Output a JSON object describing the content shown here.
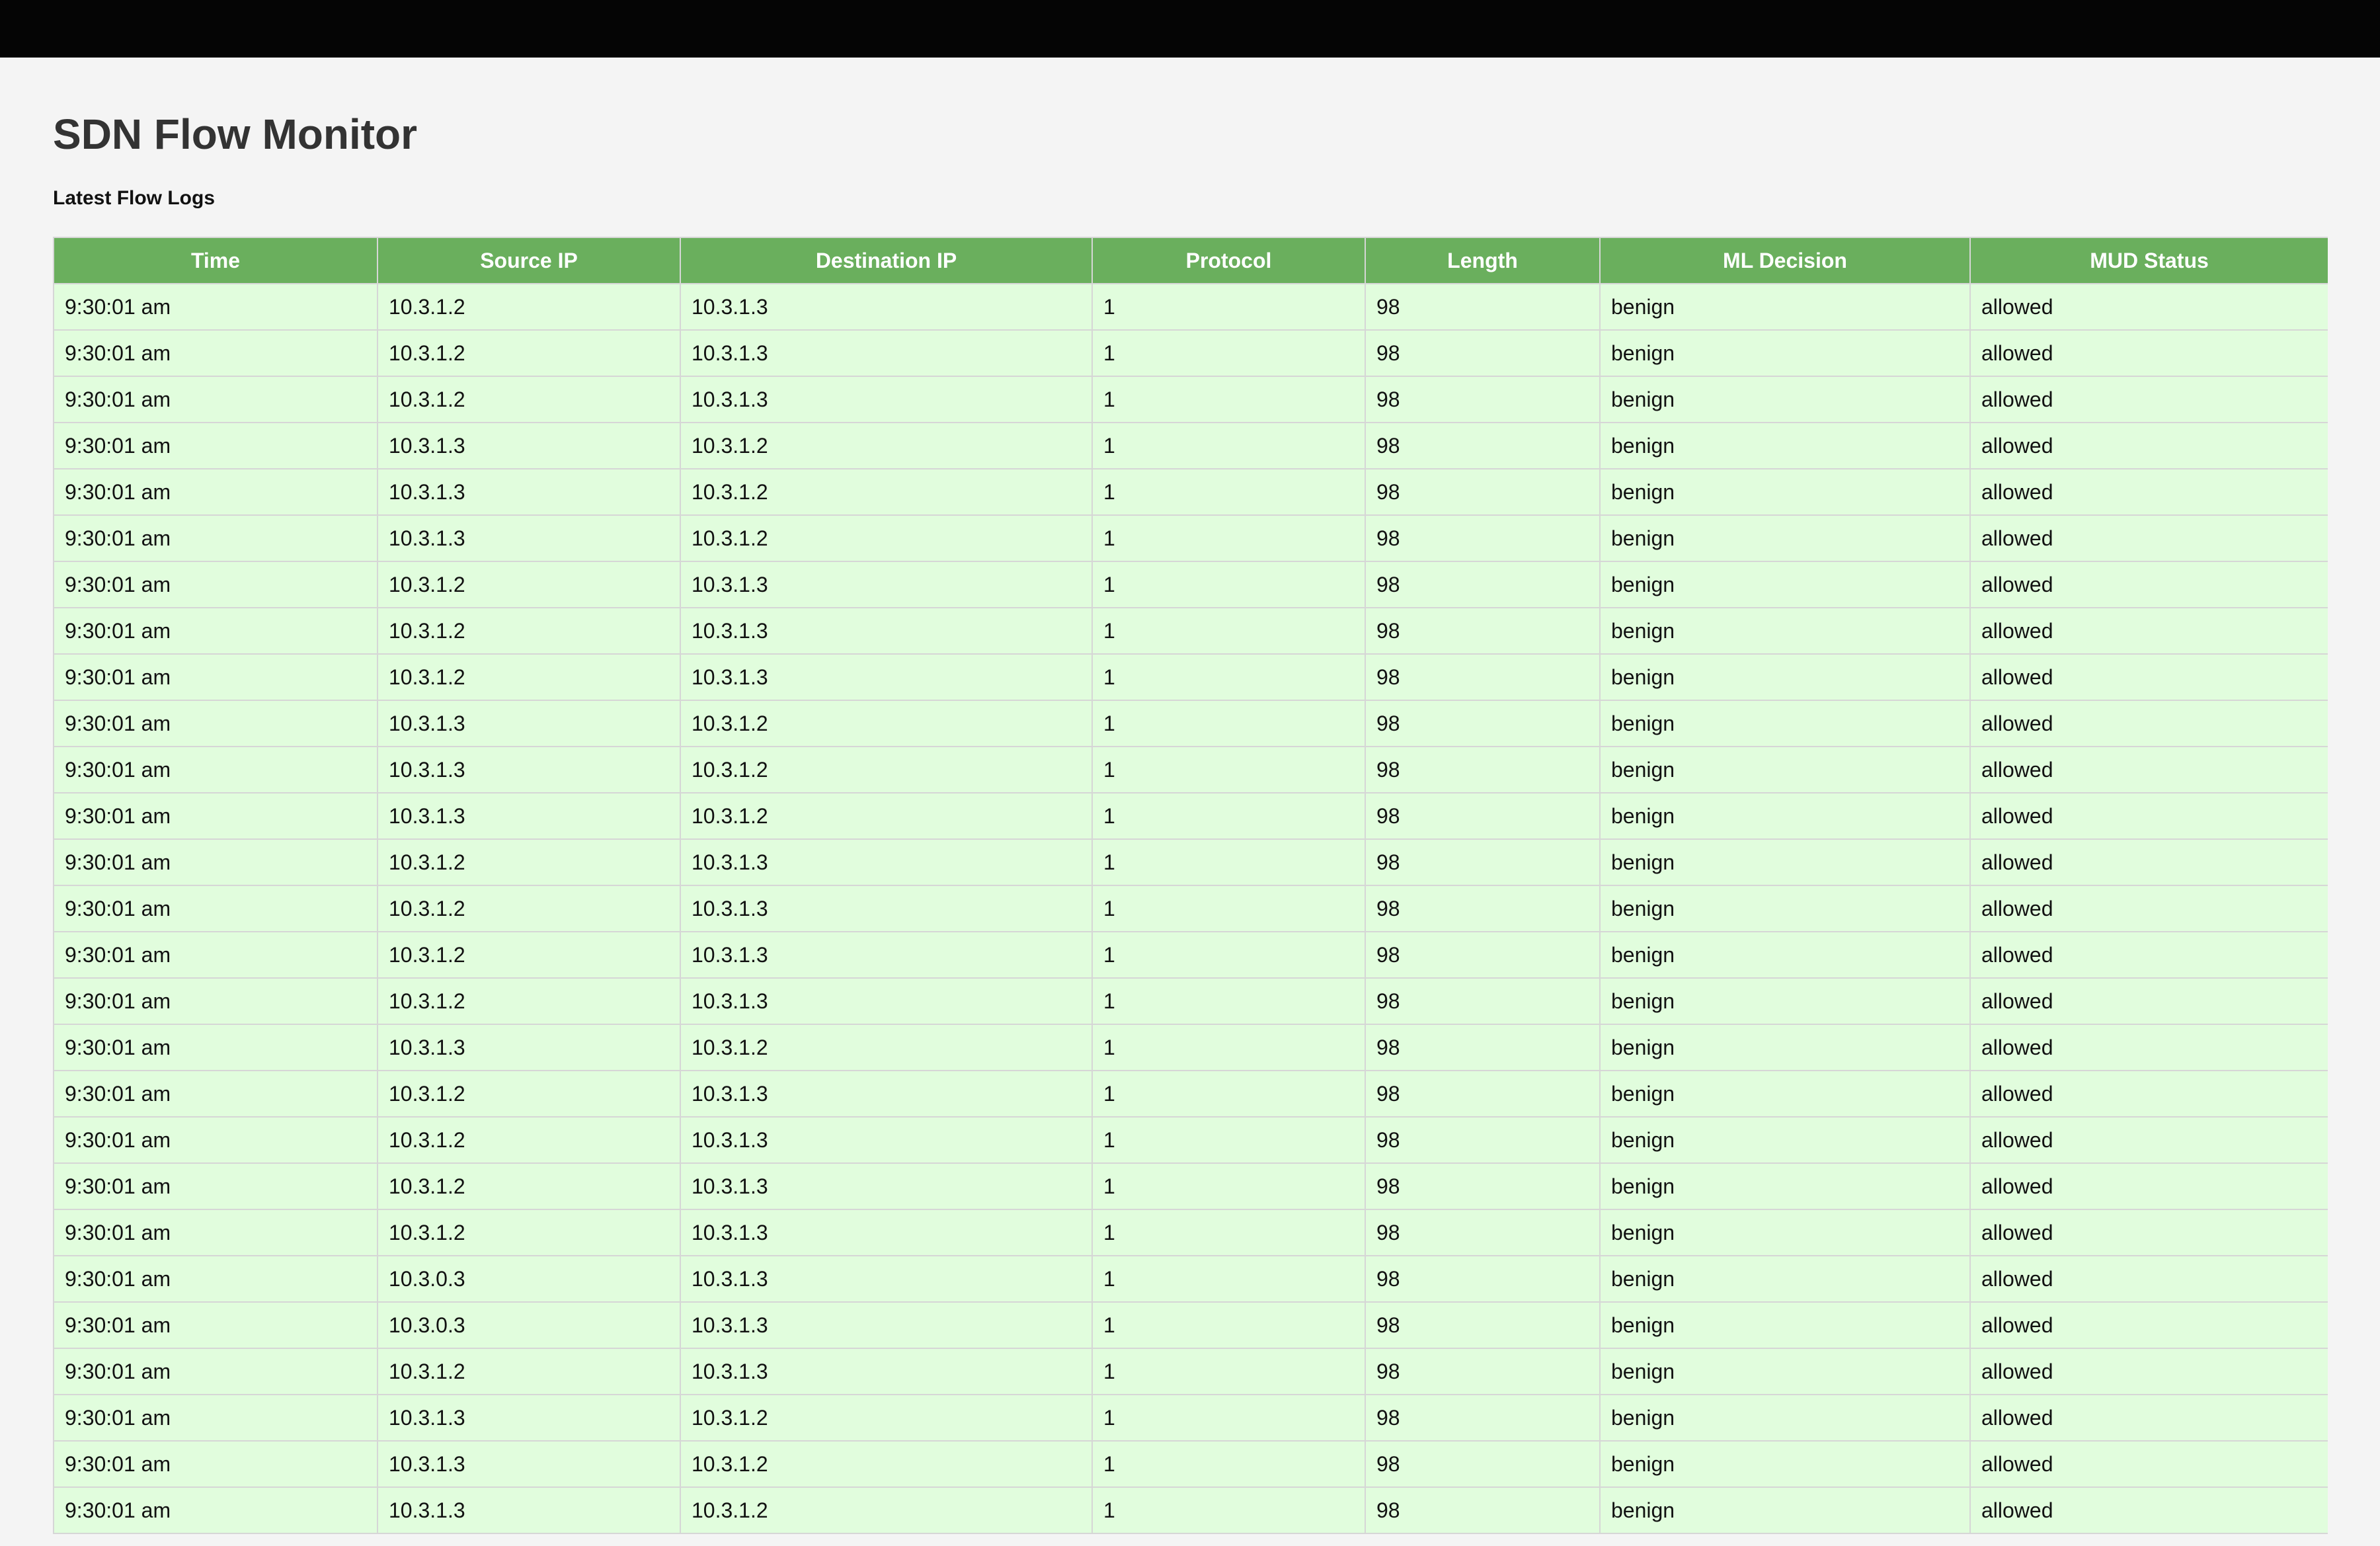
{
  "header": {
    "title": "SDN Flow Monitor",
    "subtitle": "Latest Flow Logs"
  },
  "table": {
    "columns": [
      "Time",
      "Source IP",
      "Destination IP",
      "Protocol",
      "Length",
      "ML Decision",
      "MUD Status"
    ],
    "rows": [
      [
        "9:30:01 am",
        "10.3.1.2",
        "10.3.1.3",
        "1",
        "98",
        "benign",
        "allowed"
      ],
      [
        "9:30:01 am",
        "10.3.1.2",
        "10.3.1.3",
        "1",
        "98",
        "benign",
        "allowed"
      ],
      [
        "9:30:01 am",
        "10.3.1.2",
        "10.3.1.3",
        "1",
        "98",
        "benign",
        "allowed"
      ],
      [
        "9:30:01 am",
        "10.3.1.3",
        "10.3.1.2",
        "1",
        "98",
        "benign",
        "allowed"
      ],
      [
        "9:30:01 am",
        "10.3.1.3",
        "10.3.1.2",
        "1",
        "98",
        "benign",
        "allowed"
      ],
      [
        "9:30:01 am",
        "10.3.1.3",
        "10.3.1.2",
        "1",
        "98",
        "benign",
        "allowed"
      ],
      [
        "9:30:01 am",
        "10.3.1.2",
        "10.3.1.3",
        "1",
        "98",
        "benign",
        "allowed"
      ],
      [
        "9:30:01 am",
        "10.3.1.2",
        "10.3.1.3",
        "1",
        "98",
        "benign",
        "allowed"
      ],
      [
        "9:30:01 am",
        "10.3.1.2",
        "10.3.1.3",
        "1",
        "98",
        "benign",
        "allowed"
      ],
      [
        "9:30:01 am",
        "10.3.1.3",
        "10.3.1.2",
        "1",
        "98",
        "benign",
        "allowed"
      ],
      [
        "9:30:01 am",
        "10.3.1.3",
        "10.3.1.2",
        "1",
        "98",
        "benign",
        "allowed"
      ],
      [
        "9:30:01 am",
        "10.3.1.3",
        "10.3.1.2",
        "1",
        "98",
        "benign",
        "allowed"
      ],
      [
        "9:30:01 am",
        "10.3.1.2",
        "10.3.1.3",
        "1",
        "98",
        "benign",
        "allowed"
      ],
      [
        "9:30:01 am",
        "10.3.1.2",
        "10.3.1.3",
        "1",
        "98",
        "benign",
        "allowed"
      ],
      [
        "9:30:01 am",
        "10.3.1.2",
        "10.3.1.3",
        "1",
        "98",
        "benign",
        "allowed"
      ],
      [
        "9:30:01 am",
        "10.3.1.2",
        "10.3.1.3",
        "1",
        "98",
        "benign",
        "allowed"
      ],
      [
        "9:30:01 am",
        "10.3.1.3",
        "10.3.1.2",
        "1",
        "98",
        "benign",
        "allowed"
      ],
      [
        "9:30:01 am",
        "10.3.1.2",
        "10.3.1.3",
        "1",
        "98",
        "benign",
        "allowed"
      ],
      [
        "9:30:01 am",
        "10.3.1.2",
        "10.3.1.3",
        "1",
        "98",
        "benign",
        "allowed"
      ],
      [
        "9:30:01 am",
        "10.3.1.2",
        "10.3.1.3",
        "1",
        "98",
        "benign",
        "allowed"
      ],
      [
        "9:30:01 am",
        "10.3.1.2",
        "10.3.1.3",
        "1",
        "98",
        "benign",
        "allowed"
      ],
      [
        "9:30:01 am",
        "10.3.0.3",
        "10.3.1.3",
        "1",
        "98",
        "benign",
        "allowed"
      ],
      [
        "9:30:01 am",
        "10.3.0.3",
        "10.3.1.3",
        "1",
        "98",
        "benign",
        "allowed"
      ],
      [
        "9:30:01 am",
        "10.3.1.2",
        "10.3.1.3",
        "1",
        "98",
        "benign",
        "allowed"
      ],
      [
        "9:30:01 am",
        "10.3.1.3",
        "10.3.1.2",
        "1",
        "98",
        "benign",
        "allowed"
      ],
      [
        "9:30:01 am",
        "10.3.1.3",
        "10.3.1.2",
        "1",
        "98",
        "benign",
        "allowed"
      ],
      [
        "9:30:01 am",
        "10.3.1.3",
        "10.3.1.2",
        "1",
        "98",
        "benign",
        "allowed"
      ]
    ]
  },
  "colors": {
    "top_bar": "#050505",
    "header": "#6aaf5d",
    "row": "#e1fddd",
    "border": "#d6d6d6"
  }
}
